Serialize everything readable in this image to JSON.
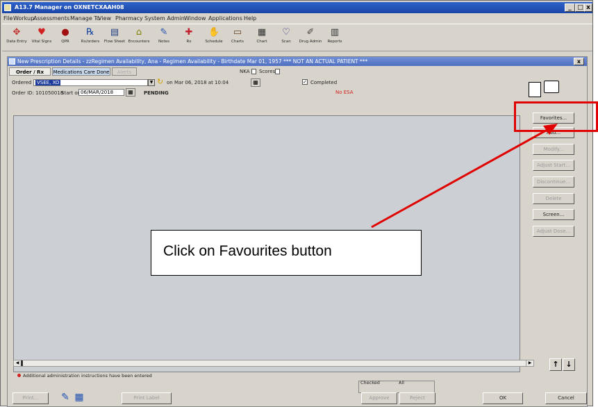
{
  "window": {
    "title": "A13.7 Manager on OXNETCXAAH08",
    "minimize": "_",
    "maximize": "□",
    "close": "x"
  },
  "menu": [
    "File",
    "Workup",
    "Assessments",
    "Manage To",
    "View",
    "Pharmacy",
    "System Admin",
    "Window",
    "Applications",
    "Help"
  ],
  "toolbar": [
    {
      "label": "Data Entry",
      "icon": "data-entry-icon",
      "glyph": "✥",
      "color": "#c03030"
    },
    {
      "label": "Vital Signs",
      "icon": "vital-signs-icon",
      "glyph": "♥",
      "color": "#d02020"
    },
    {
      "label": "QPR",
      "icon": "qpr-icon",
      "glyph": "●",
      "color": "#a01010"
    },
    {
      "label": "Rx/orders",
      "icon": "rx-icon",
      "glyph": "℞",
      "color": "#1040a0"
    },
    {
      "label": "Flow Sheet",
      "icon": "flow-sheet-icon",
      "glyph": "▤",
      "color": "#204080"
    },
    {
      "label": "Encounters",
      "icon": "encounters-icon",
      "glyph": "⌂",
      "color": "#808000"
    },
    {
      "label": "Notes",
      "icon": "notes-icon",
      "glyph": "✎",
      "color": "#2050b0"
    },
    {
      "label": "Rx",
      "icon": "rx2-icon",
      "glyph": "✚",
      "color": "#c02030"
    },
    {
      "label": "Schedule",
      "icon": "schedule-icon",
      "glyph": "✋",
      "color": "#806020"
    },
    {
      "label": "Charts",
      "icon": "charts-icon",
      "glyph": "▭",
      "color": "#604020"
    },
    {
      "label": "Chart",
      "icon": "chart-icon",
      "glyph": "▦",
      "color": "#303030"
    },
    {
      "label": "Scan",
      "icon": "scan-icon",
      "glyph": "♡",
      "color": "#202080"
    },
    {
      "label": "Drug Admin",
      "icon": "drug-admin-icon",
      "glyph": "✐",
      "color": "#504040"
    },
    {
      "label": "Reports",
      "icon": "reports-icon",
      "glyph": "▥",
      "color": "#303030"
    }
  ],
  "child": {
    "title": "New Prescription Details - zzRegimen Availability, Ana - Regimen Availability - Birthdate Mar 01, 1957 *** NOT AN ACTUAL PATIENT ***",
    "close": "x",
    "tabs": [
      "Order / Rx",
      "Medications Care Done",
      "Alerts"
    ],
    "nka_label": "NKA",
    "scores_label": "Scores",
    "ordered_by_label": "Ordered by",
    "ordered_by_value": "VSEE, XO",
    "on_date": "on Mar 06, 2018  at 10:04",
    "completed_label": "Completed",
    "completed_check": "✓",
    "order_id": "Order ID: 101050018",
    "start_label": "Start on",
    "start_value": "06/MAR/2018",
    "status": "PENDING",
    "no_esa": "No ESA",
    "side_buttons": [
      {
        "label": "Favorites...",
        "enabled": true
      },
      {
        "label": "Add...",
        "enabled": true
      },
      {
        "label": "Modify...",
        "enabled": false
      },
      {
        "label": "Adjust Start...",
        "enabled": false
      },
      {
        "label": "Discontinue...",
        "enabled": false
      },
      {
        "label": "Delete",
        "enabled": false
      },
      {
        "label": "Screen...",
        "enabled": true
      },
      {
        "label": "Adjust Dose...",
        "enabled": false
      }
    ],
    "up_arrow": "🠕",
    "down_arrow": "🠗",
    "note": "Additional administration instructions have been entered",
    "bottom": {
      "print": "Print...",
      "prescription_label": "Print Label",
      "checked_label": "Checked",
      "all_label": "All",
      "approve": "Approve",
      "reject": "Reject",
      "ok": "OK",
      "cancel": "Cancel"
    }
  },
  "callout": "Click on Favourites button",
  "annotation_color": "#e00000"
}
